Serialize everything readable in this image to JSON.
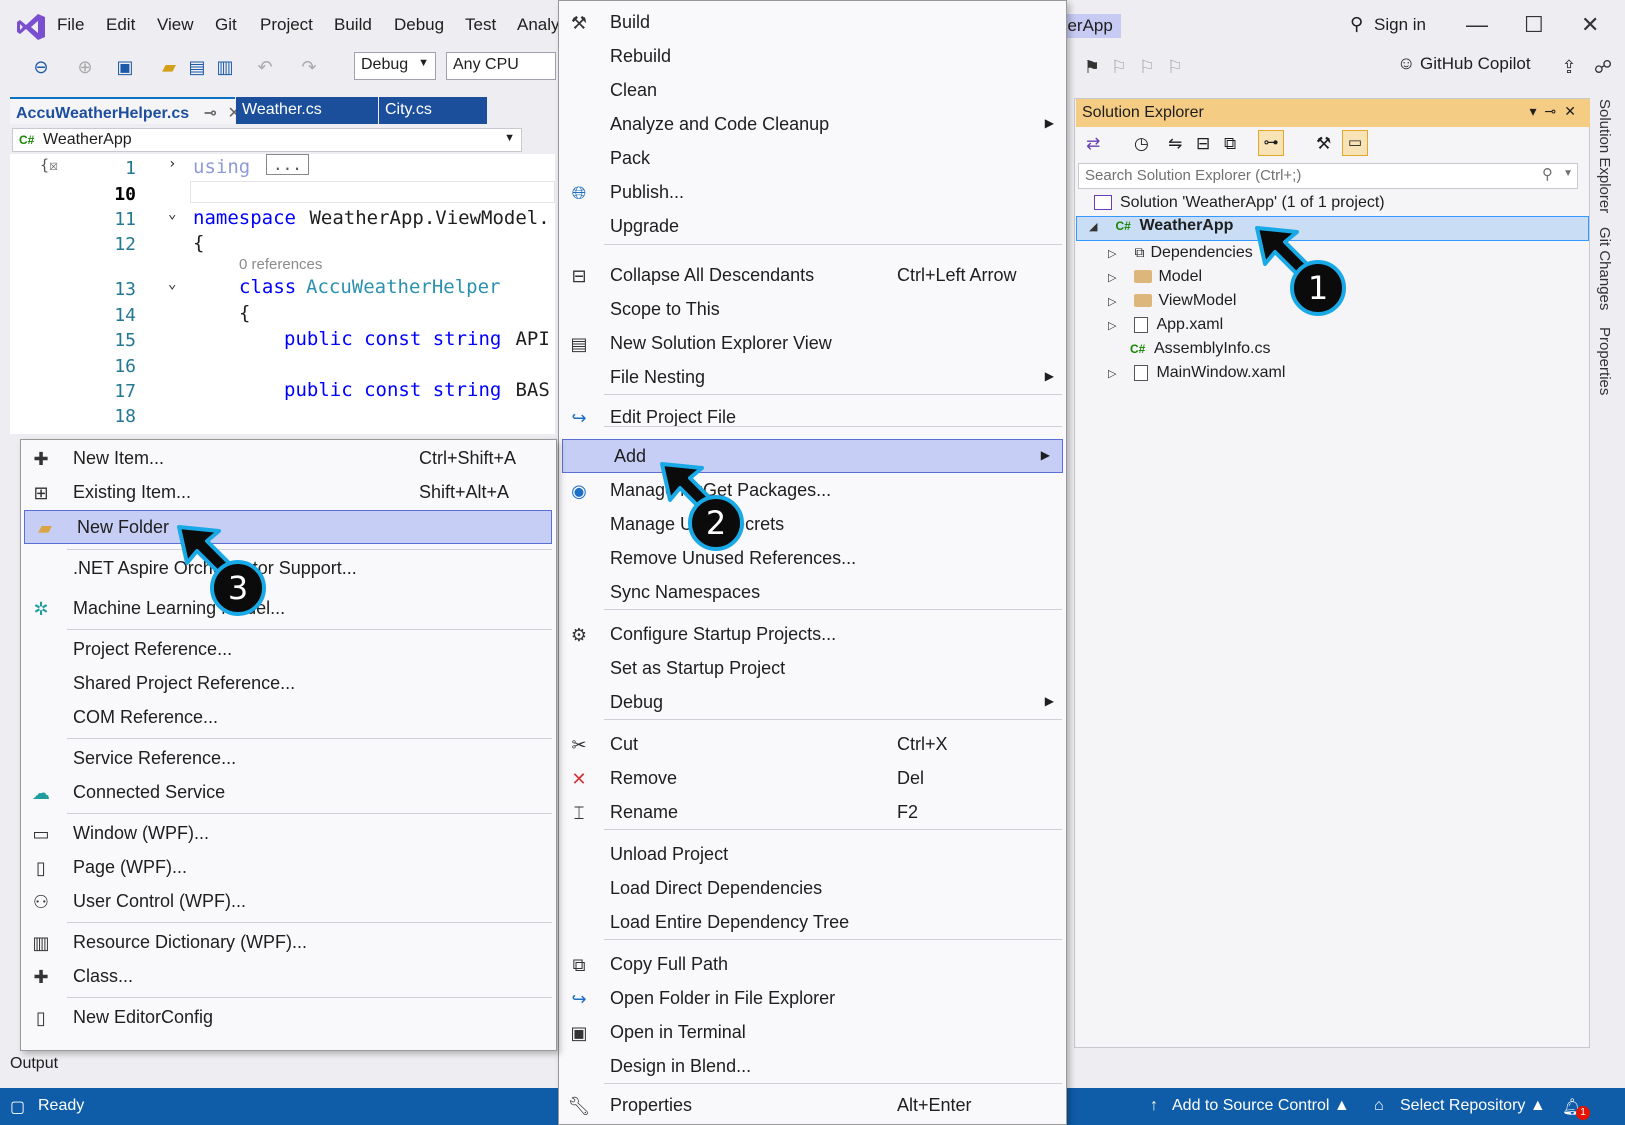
{
  "menubar": {
    "items": [
      "File",
      "Edit",
      "View",
      "Git",
      "Project",
      "Build",
      "Debug",
      "Test",
      "Analyz"
    ],
    "window_title": "herApp",
    "sign_in": "Sign in"
  },
  "toolbar": {
    "config": "Debug",
    "platform": "Any CPU",
    "copilot": "GitHub Copilot"
  },
  "editor": {
    "tabs": [
      "AccuWeatherHelper.cs",
      "Weather.cs",
      "City.cs"
    ],
    "tab_pin": "⊸",
    "tab_close": "✕",
    "nav_project": "WeatherApp",
    "lines": [
      "1",
      "10",
      "11",
      "12",
      "",
      "13",
      "14",
      "15",
      "16",
      "17",
      "18"
    ],
    "code": {
      "using": "using",
      "ellipsis": "...",
      "namespace_kw": "namespace",
      "namespace_name": " WeatherApp.ViewModel.",
      "brace_open": "{",
      "references": "0 references",
      "class_kw": "class",
      "class_name": "AccuWeatherHelper",
      "line15_kw": "public const string",
      "line15_rest": " API",
      "line17_kw": "public const string",
      "line17_rest": " BAS"
    }
  },
  "solution_explorer": {
    "title": "Solution Explorer",
    "search_placeholder": "Search Solution Explorer (Ctrl+;)",
    "solution": "Solution 'WeatherApp' (1 of 1 project)",
    "project": "WeatherApp",
    "items": [
      "Dependencies",
      "Model",
      "ViewModel",
      "App.xaml",
      "AssemblyInfo.cs",
      "MainWindow.xaml"
    ],
    "side_tabs": [
      "Solution Explorer",
      "Git Changes",
      "Properties"
    ]
  },
  "project_menu": {
    "items": [
      {
        "label": "Build",
        "shortcut": ""
      },
      {
        "label": "Rebuild",
        "shortcut": ""
      },
      {
        "label": "Clean",
        "shortcut": ""
      },
      {
        "label": "Analyze and Code Cleanup",
        "shortcut": ""
      },
      {
        "label": "Pack",
        "shortcut": ""
      },
      {
        "label": "Publish...",
        "shortcut": ""
      },
      {
        "label": "Upgrade",
        "shortcut": ""
      },
      {
        "label": "Collapse All Descendants",
        "shortcut": "Ctrl+Left Arrow"
      },
      {
        "label": "Scope to This",
        "shortcut": ""
      },
      {
        "label": "New Solution Explorer View",
        "shortcut": ""
      },
      {
        "label": "File Nesting",
        "shortcut": ""
      },
      {
        "label": "Edit Project File",
        "shortcut": ""
      },
      {
        "label": "Add",
        "shortcut": ""
      },
      {
        "label": "Manage NuGet Packages...",
        "shortcut": ""
      },
      {
        "label": "Manage User Secrets",
        "shortcut": ""
      },
      {
        "label": "Remove Unused References...",
        "shortcut": ""
      },
      {
        "label": "Sync Namespaces",
        "shortcut": ""
      },
      {
        "label": "Configure Startup Projects...",
        "shortcut": ""
      },
      {
        "label": "Set as Startup Project",
        "shortcut": ""
      },
      {
        "label": "Debug",
        "shortcut": ""
      },
      {
        "label": "Cut",
        "shortcut": "Ctrl+X"
      },
      {
        "label": "Remove",
        "shortcut": "Del"
      },
      {
        "label": "Rename",
        "shortcut": "F2"
      },
      {
        "label": "Unload Project",
        "shortcut": ""
      },
      {
        "label": "Load Direct Dependencies",
        "shortcut": ""
      },
      {
        "label": "Load Entire Dependency Tree",
        "shortcut": ""
      },
      {
        "label": "Copy Full Path",
        "shortcut": ""
      },
      {
        "label": "Open Folder in File Explorer",
        "shortcut": ""
      },
      {
        "label": "Open in Terminal",
        "shortcut": ""
      },
      {
        "label": "Design in Blend...",
        "shortcut": ""
      },
      {
        "label": "Properties",
        "shortcut": "Alt+Enter"
      }
    ]
  },
  "add_menu": {
    "items": [
      {
        "label": "New Item...",
        "shortcut": "Ctrl+Shift+A"
      },
      {
        "label": "Existing Item...",
        "shortcut": "Shift+Alt+A"
      },
      {
        "label": "New Folder",
        "shortcut": ""
      },
      {
        "label": ".NET Aspire Orchestrator Support...",
        "shortcut": ""
      },
      {
        "label": "Machine Learning Model...",
        "shortcut": ""
      },
      {
        "label": "Project Reference...",
        "shortcut": ""
      },
      {
        "label": "Shared Project Reference...",
        "shortcut": ""
      },
      {
        "label": "COM Reference...",
        "shortcut": ""
      },
      {
        "label": "Service Reference...",
        "shortcut": ""
      },
      {
        "label": "Connected Service",
        "shortcut": ""
      },
      {
        "label": "Window (WPF)...",
        "shortcut": ""
      },
      {
        "label": "Page (WPF)...",
        "shortcut": ""
      },
      {
        "label": "User Control (WPF)...",
        "shortcut": ""
      },
      {
        "label": "Resource Dictionary (WPF)...",
        "shortcut": ""
      },
      {
        "label": "Class...",
        "shortcut": ""
      },
      {
        "label": "New EditorConfig",
        "shortcut": ""
      }
    ]
  },
  "callouts": [
    "1",
    "2",
    "3"
  ],
  "status": {
    "output": "Output",
    "ready": "Ready",
    "source_control": "Add to Source Control",
    "repository": "Select Repository",
    "notifications": "1"
  },
  "colors": {
    "accent": "#0f5ca8",
    "menu_highlight": "#c6cef5",
    "callout_border": "#19a9e6",
    "se_header": "#f5cc84"
  }
}
